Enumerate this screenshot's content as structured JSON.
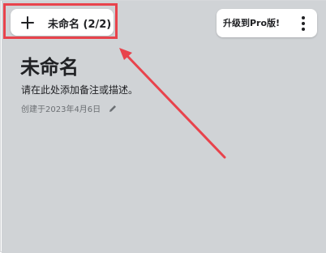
{
  "toolbar": {
    "add_icon": "plus-icon",
    "map_title": "未命名 (2/2)",
    "upgrade_label": "升级到Pro版!",
    "more_icon": "more-vertical-icon"
  },
  "content": {
    "title": "未命名",
    "description": "请在此处添加备注或描述。",
    "created": "创建于2023年4月6日",
    "edit_icon": "pencil-icon"
  },
  "annotation": {
    "color": "#e8434c"
  },
  "colors": {
    "background": "#d0d3d6",
    "card": "#ffffff",
    "text": "#202124",
    "muted_text": "#6b6f73"
  }
}
